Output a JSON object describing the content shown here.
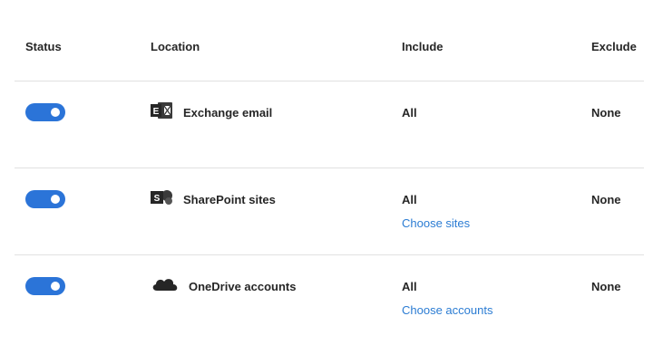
{
  "columns": {
    "status": "Status",
    "location": "Location",
    "include": "Include",
    "exclude": "Exclude"
  },
  "rows": [
    {
      "status_on": true,
      "icon": "exchange-icon",
      "location": "Exchange email",
      "include": "All",
      "include_link": "",
      "exclude": "None"
    },
    {
      "status_on": true,
      "icon": "sharepoint-icon",
      "location": "SharePoint sites",
      "include": "All",
      "include_link": "Choose sites",
      "exclude": "None"
    },
    {
      "status_on": true,
      "icon": "onedrive-icon",
      "location": "OneDrive accounts",
      "include": "All",
      "include_link": "Choose accounts",
      "exclude": "None"
    }
  ],
  "colors": {
    "toggle_on": "#2b74d8",
    "link": "#2b7cd3",
    "text": "#262626",
    "divider": "#e1e1e1"
  }
}
